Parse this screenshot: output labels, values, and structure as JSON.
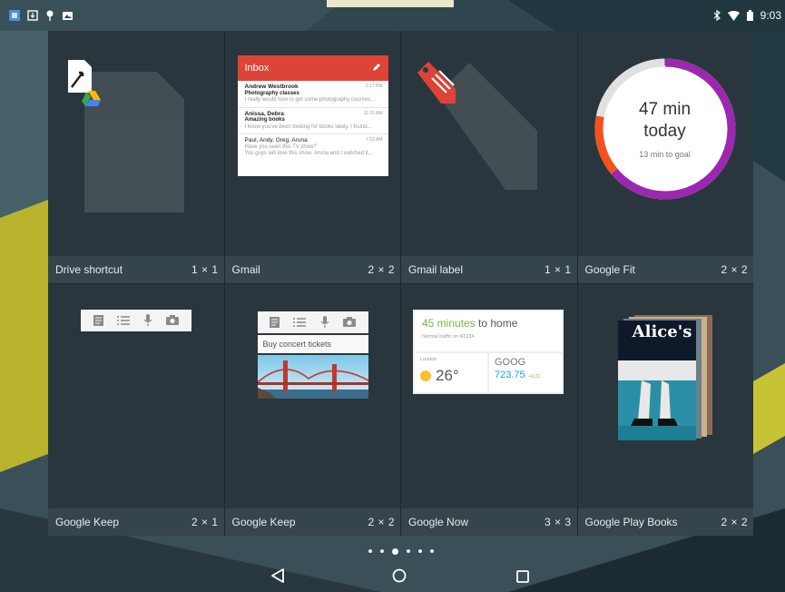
{
  "status_bar": {
    "time": "9:03",
    "left_icons": [
      "app-icon",
      "download-icon",
      "location-pin-icon",
      "photo-icon"
    ],
    "right_icons": [
      "bluetooth-icon",
      "wifi-icon",
      "battery-icon"
    ]
  },
  "widgets": [
    {
      "name": "Drive shortcut",
      "size": "1 × 1"
    },
    {
      "name": "Gmail",
      "size": "2 × 2"
    },
    {
      "name": "Gmail label",
      "size": "1 × 1"
    },
    {
      "name": "Google Fit",
      "size": "2 × 2"
    },
    {
      "name": "Google Keep",
      "size": "2 × 1"
    },
    {
      "name": "Google Keep",
      "size": "2 × 2"
    },
    {
      "name": "Google Now",
      "size": "3 × 3"
    },
    {
      "name": "Google Play Books",
      "size": "2 × 2"
    }
  ],
  "gmail_preview": {
    "title": "Inbox",
    "messages": [
      {
        "from": "Andrew Westbrook",
        "subject": "Photography classes",
        "snippet": "I really would love to get some photography courses...",
        "time": "2:17 PM"
      },
      {
        "from": "Anissa, Debra",
        "subject": "Amazing books",
        "snippet": "I know you've been looking for books lately. I found...",
        "time": "11:15 AM"
      },
      {
        "from": "Paul, Andy, Greg, Aruna",
        "subject": "Have you seen this TV show?",
        "snippet": "You guys will love this show. Aruna and I watched it...",
        "time": "7:13 AM"
      }
    ]
  },
  "fit_preview": {
    "value": "47 min",
    "period": "today",
    "goal": "13 min to goal",
    "progress": 0.78,
    "colors": {
      "track": "#e0e0e0",
      "main": "#9c27b0",
      "start": "#f4511e"
    }
  },
  "keep_preview": {
    "note": "Buy concert tickets",
    "icons": [
      "note-icon",
      "list-icon",
      "mic-icon",
      "camera-icon"
    ]
  },
  "now_preview": {
    "traffic_value": "45 minutes",
    "traffic_rest": " to home",
    "traffic_detail": "Normal traffic on A1234",
    "city": "London",
    "temperature": "26°",
    "stock_symbol": "GOOG",
    "stock_price": "723.75",
    "stock_change": "+0.21"
  },
  "books_preview": {
    "cover_title": "Alice's"
  },
  "pager": {
    "count": 6,
    "active": 2
  },
  "nav": {
    "icons": [
      "back-icon",
      "home-icon",
      "recents-icon"
    ]
  }
}
